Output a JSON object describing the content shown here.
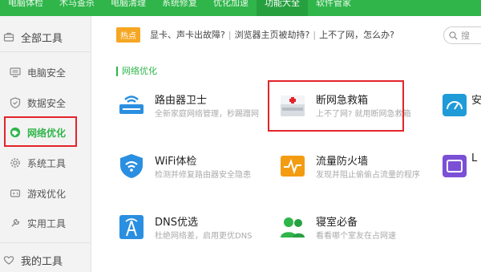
{
  "top_tabs": [
    {
      "label": "电脑体检",
      "active": false
    },
    {
      "label": "木马查杀",
      "active": false
    },
    {
      "label": "电脑清理",
      "active": false
    },
    {
      "label": "系统修复",
      "active": false
    },
    {
      "label": "优化加速",
      "active": false
    },
    {
      "label": "功能大全",
      "active": true
    },
    {
      "label": "软件管家",
      "active": false
    }
  ],
  "sidebar": {
    "all_tools": "全部工具",
    "items": [
      {
        "label": "电脑安全",
        "icon": "monitor-icon",
        "active": false
      },
      {
        "label": "数据安全",
        "icon": "shield-check-icon",
        "active": false
      },
      {
        "label": "网络优化",
        "icon": "globe-icon",
        "active": true
      },
      {
        "label": "系统工具",
        "icon": "gear-icon",
        "active": false
      },
      {
        "label": "游戏优化",
        "icon": "gamepad-icon",
        "active": false
      },
      {
        "label": "实用工具",
        "icon": "wrench-icon",
        "active": false
      }
    ],
    "my_tools": "我的工具"
  },
  "notice": {
    "badge": "热点",
    "links": [
      "显卡、声卡出故障?",
      "浏览器主页被劫持?",
      "上不了网，怎么办?"
    ]
  },
  "search": {
    "placeholder": "搜"
  },
  "section": {
    "title": "网络优化"
  },
  "tools": [
    {
      "name": "路由器卫士",
      "desc": "全新家庭网络管理，秒踢蹭网",
      "icon": "router-icon"
    },
    {
      "name": "断网急救箱",
      "desc": "上不了网? 就用断网急救箱",
      "icon": "first-aid-kit-icon"
    },
    {
      "name": "WiFi体检",
      "desc": "检测并修复路由器安全隐患",
      "icon": "wifi-shield-icon"
    },
    {
      "name": "流量防火墙",
      "desc": "发现并阻止偷偷占流量的程序",
      "icon": "firewall-icon"
    },
    {
      "name": "DNS优选",
      "desc": "杜绝网络差，启用更优DNS",
      "icon": "dns-tower-icon"
    },
    {
      "name": "寝室必备",
      "desc": "看看哪个室友在占网速",
      "icon": "roommates-icon"
    }
  ],
  "colors": {
    "brand_green": "#2fb54a",
    "highlight_red": "#e3242b",
    "hot_orange": "#f5a623"
  }
}
